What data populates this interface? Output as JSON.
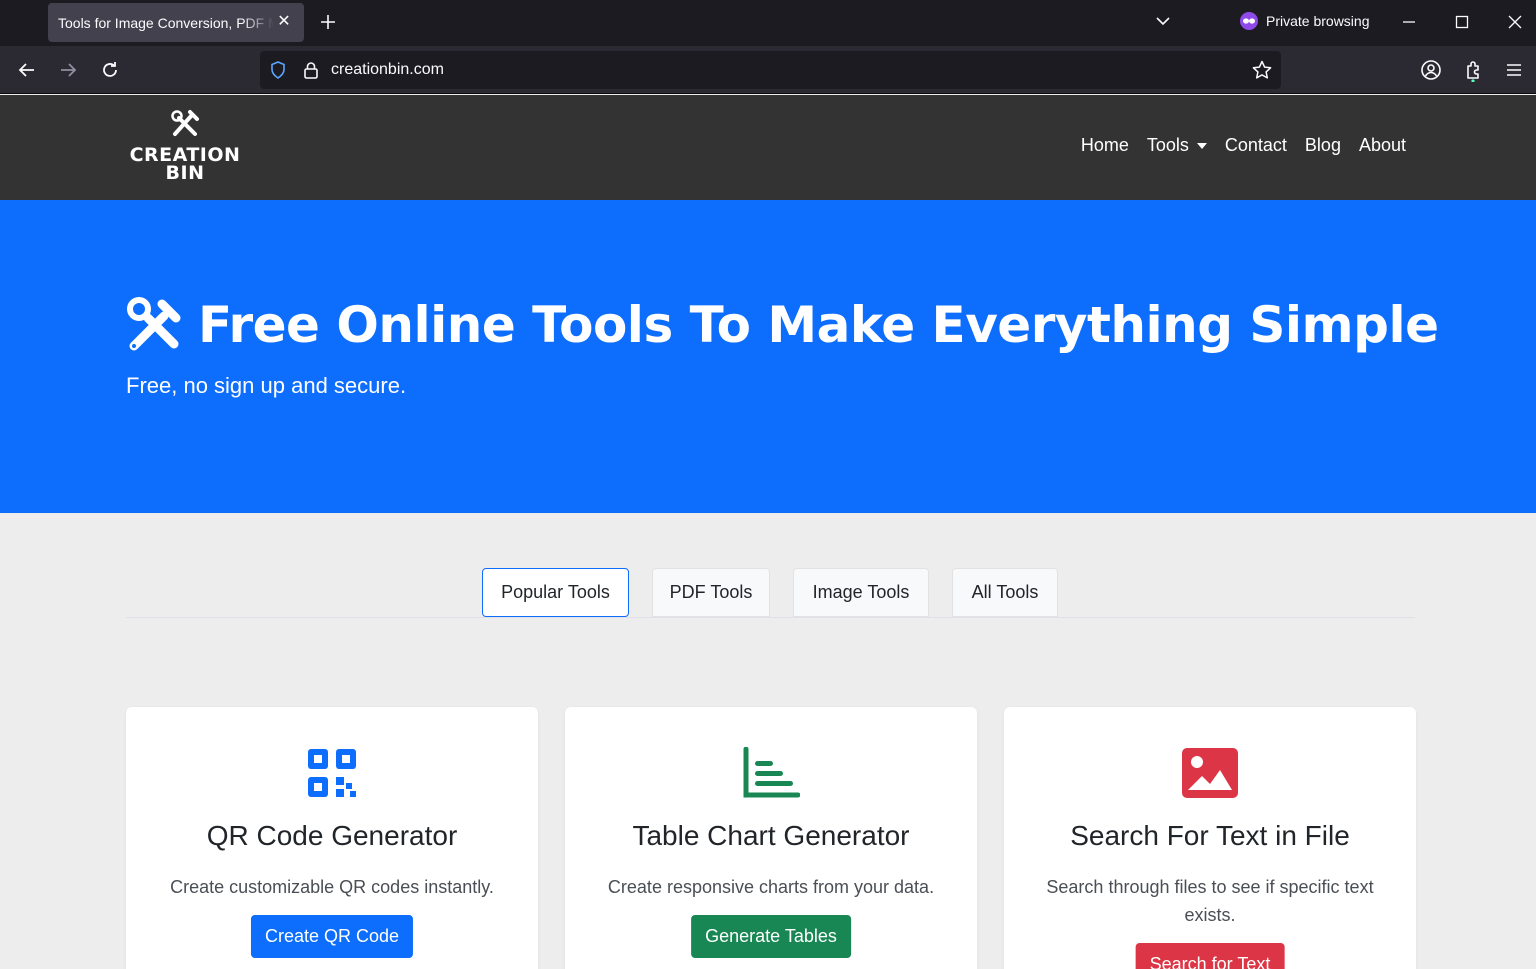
{
  "browser": {
    "tab_title": "Tools for Image Conversion, PDF Manipulation",
    "private_label": "Private browsing",
    "url": "creationbin.com"
  },
  "site": {
    "logo_line1": "CREATION",
    "logo_line2": "BIN",
    "nav": {
      "home": "Home",
      "tools": "Tools",
      "contact": "Contact",
      "blog": "Blog",
      "about": "About"
    }
  },
  "hero": {
    "title": "Free Online Tools To Make Everything Simple",
    "subtitle": "Free, no sign up and secure."
  },
  "tabs": [
    {
      "label": "Popular Tools",
      "active": true
    },
    {
      "label": "PDF Tools",
      "active": false
    },
    {
      "label": "Image Tools",
      "active": false
    },
    {
      "label": "All Tools",
      "active": false
    }
  ],
  "cards": [
    {
      "title": "QR Code Generator",
      "description": "Create customizable QR codes instantly.",
      "button": "Create QR Code",
      "icon": "qr-code-icon",
      "color": "#0d6efd"
    },
    {
      "title": "Table Chart Generator",
      "description": "Create responsive charts from your data.",
      "button": "Generate Tables",
      "icon": "bar-chart-icon",
      "color": "#198754"
    },
    {
      "title": "Search For Text in File",
      "description": "Search through files to see if specific text exists.",
      "button": "Search for Text",
      "icon": "image-icon",
      "color": "#dc3545"
    }
  ]
}
